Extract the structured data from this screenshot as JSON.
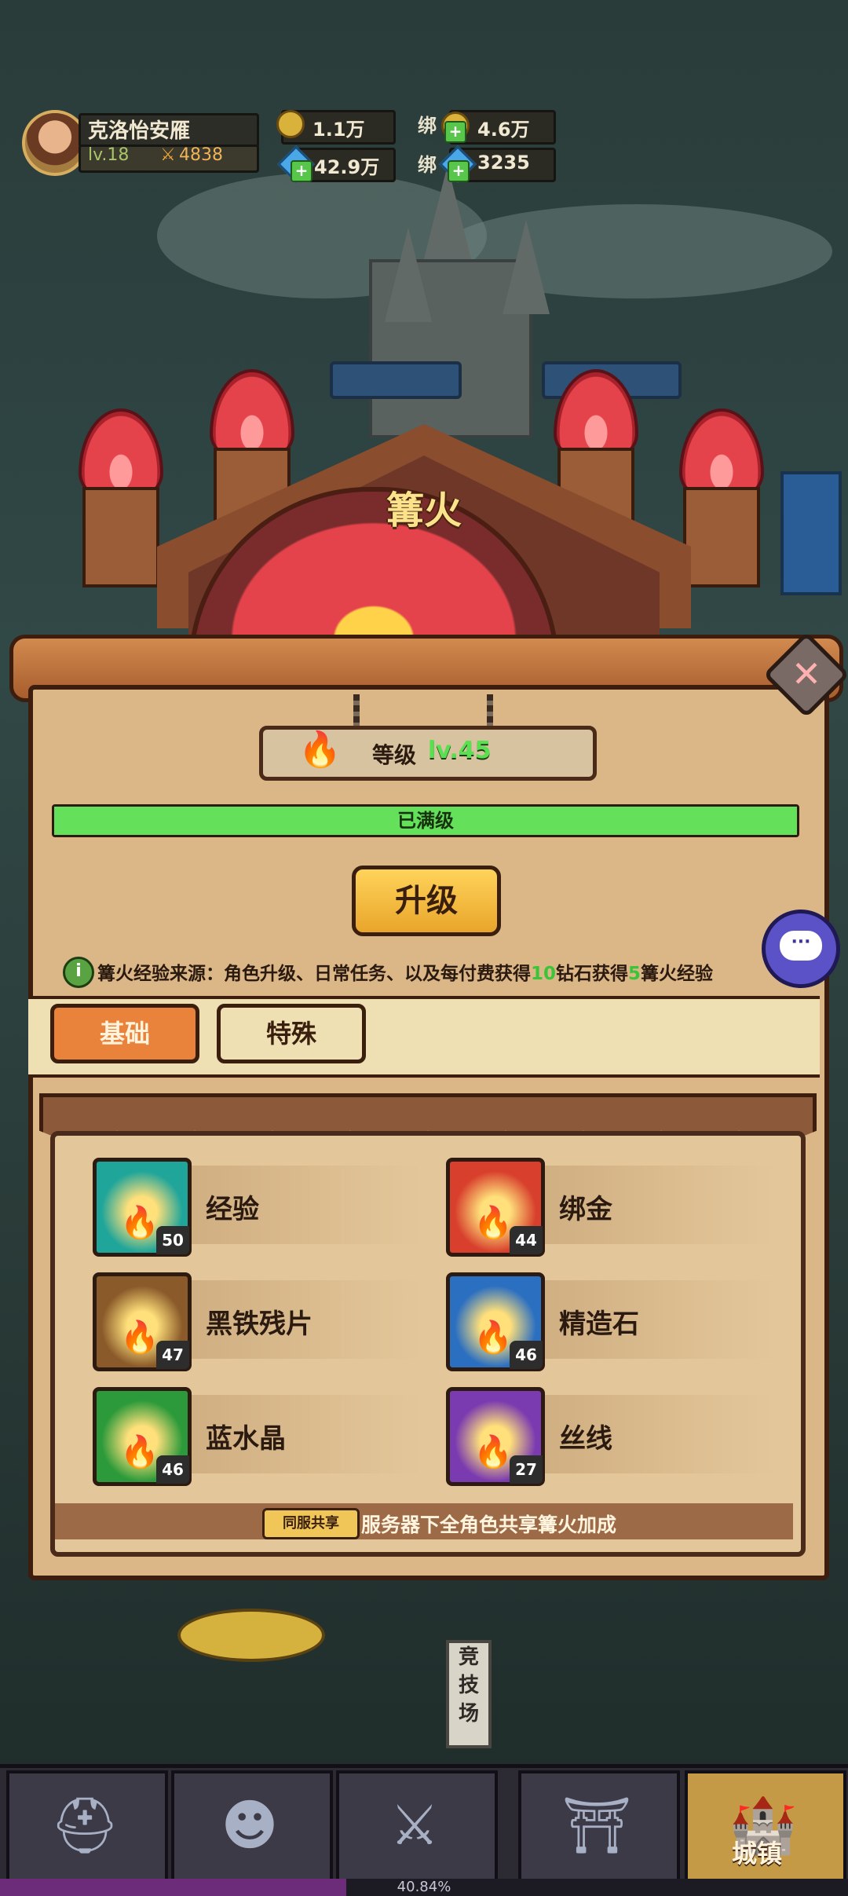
{
  "player": {
    "name": "克洛怡安雁",
    "level": "lv.18",
    "power": "4838"
  },
  "resources": {
    "gold": "1.1万",
    "bound_gold_label": "绑",
    "bound_gold": "4.6万",
    "diamond": "42.9万",
    "bound_diamond_label": "绑",
    "bound_diamond": "3235"
  },
  "bonfire": {
    "title": "篝火",
    "level_label": "等级",
    "level_value": "lv.45",
    "progress_text": "已满级",
    "progress_fraction": 1.0,
    "upgrade_label": "升级",
    "info_prefix": "篝火经验来源：角色升级、日常任务、以及每付费获得",
    "info_num1": "10",
    "info_mid": "钻石获得",
    "info_num2": "5",
    "info_suffix": "篝火经验"
  },
  "tabs": {
    "basic": "基础",
    "special": "特殊"
  },
  "items": [
    {
      "label": "经验",
      "count": "50",
      "color": "#1fa59a",
      "icon": "emerald-book-icon"
    },
    {
      "label": "绑金",
      "count": "44",
      "color": "#d8402d",
      "icon": "gold-coin-icon"
    },
    {
      "label": "黑铁残片",
      "count": "47",
      "color": "#8a5a2a",
      "icon": "iron-shard-icon"
    },
    {
      "label": "精造石",
      "count": "46",
      "color": "#2b6fc1",
      "icon": "blue-stone-icon"
    },
    {
      "label": "蓝水晶",
      "count": "46",
      "color": "#2c9a3a",
      "icon": "blue-crystal-icon"
    },
    {
      "label": "丝线",
      "count": "27",
      "color": "#7a3ab0",
      "icon": "silk-thread-icon"
    }
  ],
  "share": {
    "tag": "同服共享",
    "text": "服务器下全角色共享篝火加成"
  },
  "world_labels": {
    "arena": "竞技场"
  },
  "nav": {
    "town_label": "城镇"
  },
  "xp": {
    "text": "40.84%",
    "fraction": 0.4084
  }
}
